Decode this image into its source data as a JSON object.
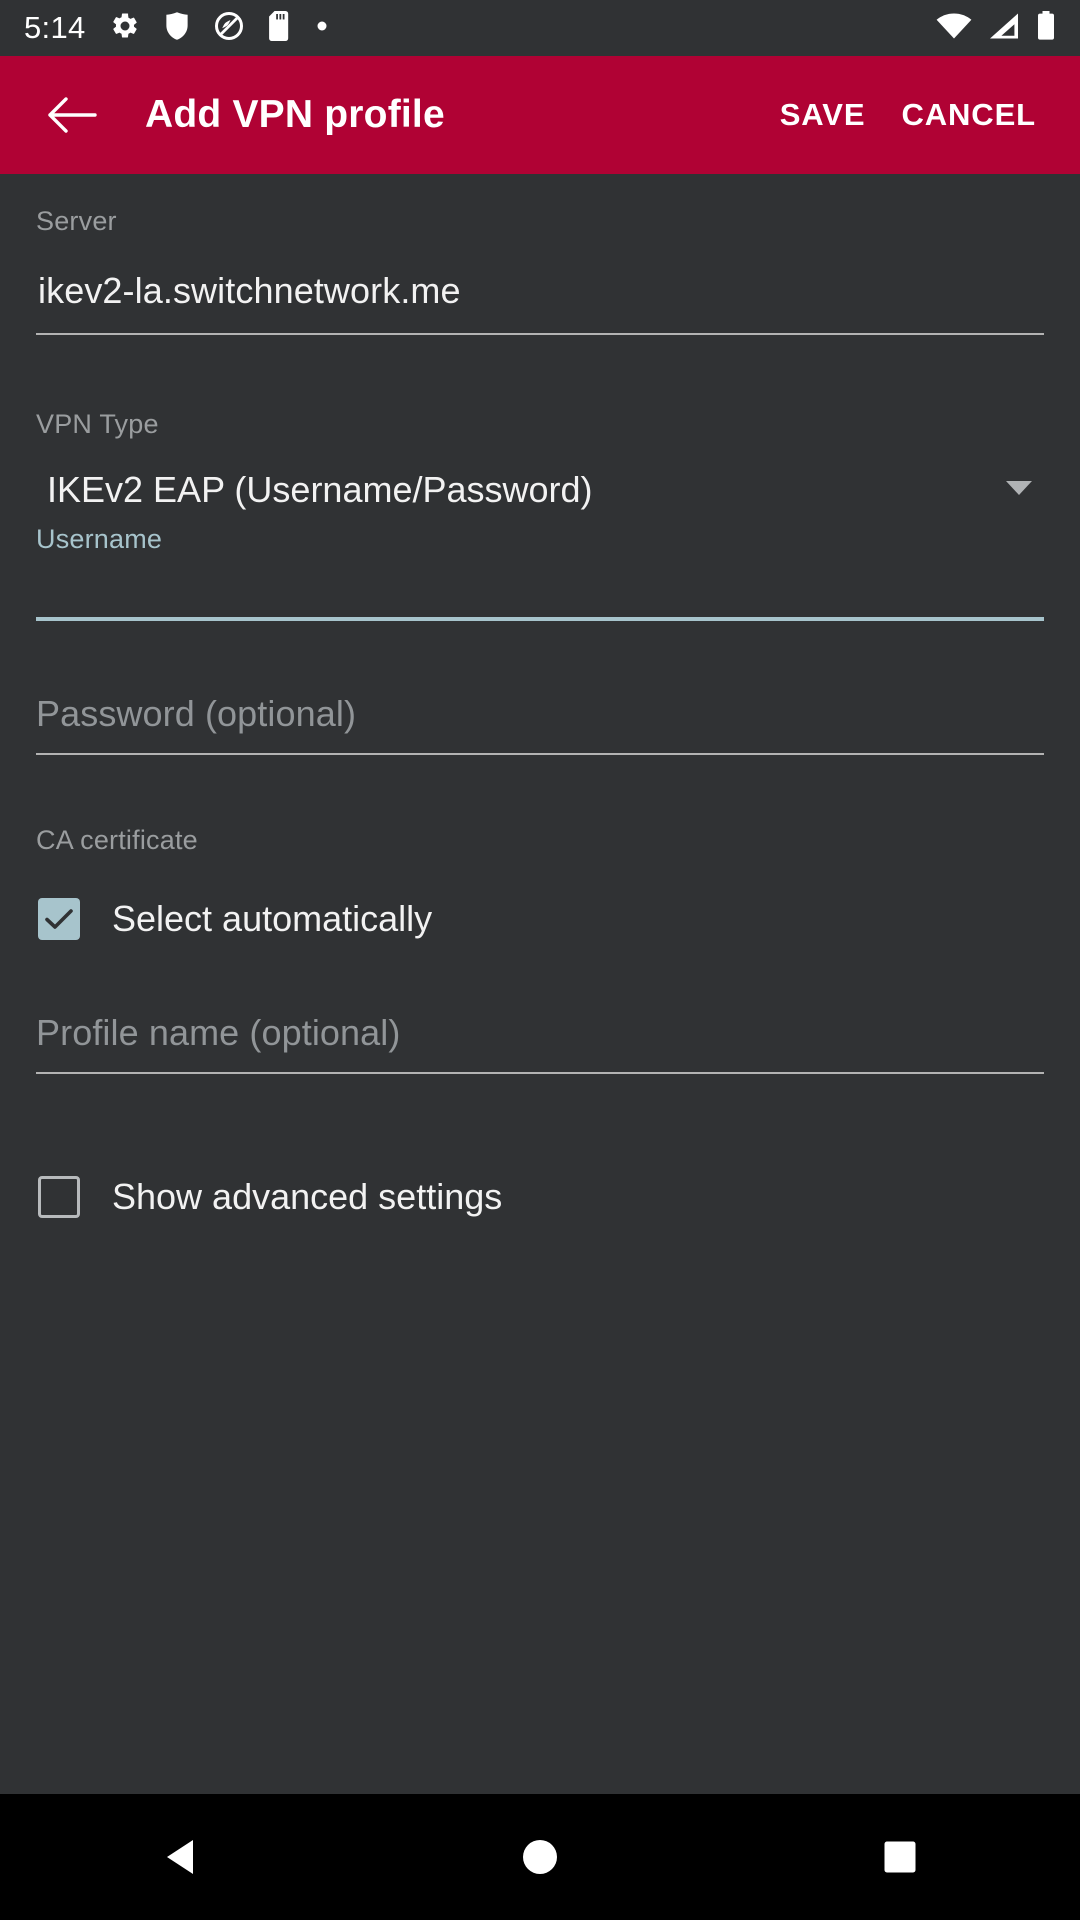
{
  "statusbar": {
    "time": "5:14",
    "left_icons": [
      {
        "name": "gear-icon"
      },
      {
        "name": "shield-icon"
      },
      {
        "name": "do-not-disturb-icon"
      },
      {
        "name": "sd-card-icon"
      },
      {
        "name": "dot-icon"
      }
    ],
    "right_icons": [
      {
        "name": "wifi-icon"
      },
      {
        "name": "cellular-signal-icon"
      },
      {
        "name": "battery-icon"
      }
    ]
  },
  "appbar": {
    "back_label": "Back",
    "title": "Add VPN profile",
    "save_label": "SAVE",
    "cancel_label": "CANCEL",
    "background_color": "#B00234"
  },
  "form": {
    "server": {
      "label": "Server",
      "value": "ikev2-la.switchnetwork.me",
      "placeholder": "Server"
    },
    "vpn_type": {
      "label": "VPN Type",
      "value": "IKEv2 EAP (Username/Password)",
      "caret": "chevron-down-icon"
    },
    "username": {
      "label": "Username",
      "value": "",
      "placeholder": "Username",
      "focused": true,
      "accent_color": "#A7C4CC"
    },
    "password": {
      "label": "Password (optional)",
      "value": "",
      "placeholder": "Password (optional)"
    },
    "ca_certificate": {
      "label": "CA certificate",
      "checkbox_label": "Select automatically",
      "checked": true
    },
    "profile_name": {
      "label": "Profile name (optional)",
      "value": "",
      "placeholder": "Profile name (optional)"
    },
    "advanced": {
      "checkbox_label": "Show advanced settings",
      "checked": false
    }
  },
  "navbar": {
    "back": "back-triangle-icon",
    "home": "home-circle-icon",
    "recents": "recents-square-icon"
  }
}
